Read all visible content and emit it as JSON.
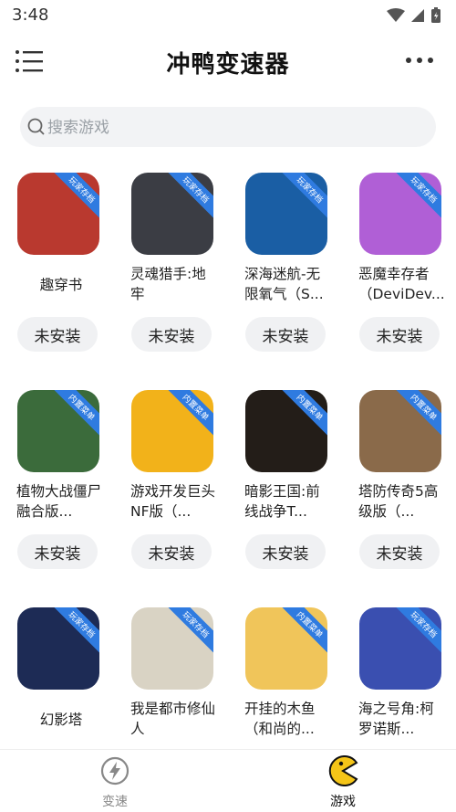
{
  "status": {
    "time": "3:48"
  },
  "app": {
    "title": "冲鸭变速器"
  },
  "search": {
    "placeholder": "搜索游戏"
  },
  "badges": {
    "player": "玩家存档",
    "builtin": "内置菜单"
  },
  "colors": {
    "accent": "#f5c518",
    "ribbon": "#2f7be0"
  },
  "games": [
    {
      "name": "趣穿书",
      "single": true,
      "action": "未安装",
      "icon_bg": "#b9392f"
    },
    {
      "name": "灵魂猎手:地牢",
      "single": false,
      "action": "未安装",
      "icon_bg": "#3b3d44"
    },
    {
      "name": "深海迷航-无限氧气（S...",
      "single": false,
      "action": "未安装",
      "icon_bg": "#1a5ea4"
    },
    {
      "name": "恶魔幸存者（DeviDev...",
      "single": false,
      "action": "未安装",
      "icon_bg": "#b05fd6"
    },
    {
      "name": "植物大战僵尸融合版...",
      "single": false,
      "action": "未安装",
      "icon_bg": "#3b6b3b"
    },
    {
      "name": "游戏开发巨头NF版（...",
      "single": false,
      "action": "未安装",
      "icon_bg": "#f2b21a"
    },
    {
      "name": "暗影王国:前线战争T...",
      "single": false,
      "action": "未安装",
      "icon_bg": "#231d18"
    },
    {
      "name": "塔防传奇5高级版（...",
      "single": false,
      "action": "未安装",
      "icon_bg": "#8a6a4a"
    },
    {
      "name": "幻影塔",
      "single": true,
      "action": "",
      "icon_bg": "#1d2b55"
    },
    {
      "name": "我是都市修仙人",
      "single": false,
      "action": "",
      "icon_bg": "#d9d3c4"
    },
    {
      "name": "开挂的木鱼（和尚的...",
      "single": false,
      "action": "",
      "icon_bg": "#f0c55a"
    },
    {
      "name": "海之号角:柯罗诺斯...",
      "single": false,
      "action": "",
      "icon_bg": "#3a4fb0"
    }
  ],
  "tabs": [
    {
      "label": "变速"
    },
    {
      "label": "游戏"
    }
  ]
}
